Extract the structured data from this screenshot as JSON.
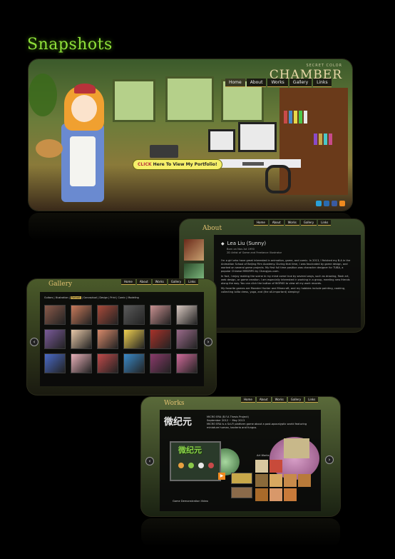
{
  "page": {
    "title": "Snapshots"
  },
  "nav": [
    "Home",
    "About",
    "Works",
    "Gallery",
    "Links"
  ],
  "brand": {
    "small": "SECRET COLOR",
    "big": "CHAMBER"
  },
  "shot1": {
    "bubble_prefix": "CLICK",
    "bubble_text": " Here To View My Portfolio!"
  },
  "about": {
    "section": "About",
    "name": "Lea Liu (Sunny)",
    "born": "Born on Nov.1st 1990",
    "role": "2D Artist of Game and Freelance Illustrator",
    "para1": "I'm a girl who have great interested in animation, game, and comic. In 2013, I finished my B.A in the Animation School of Beijing Film Academy. During that time, I was fascinated by game design, and worked on several game projects. My first full time position was character designer for TUBA, a popular Chinese MMORPG by Changyou.com.",
    "para2": "In fact, I enjoy making the scene in my mind come true by several ways, such as drawing, flash art, web design, or game creation. I am especially interested in working in a group, meeting new friends along the way. You can click the button of WORKS to view all my work records.",
    "para3": "My favorite games are Monster Hunter and Minecraft, and my hobbies include painting, cooking, collecting lolita dress, yoga, and (the all-important) sleeping!"
  },
  "gallery": {
    "section": "Gallery",
    "filters": [
      "Guitars",
      "Illustration",
      "Portrait",
      "Conceptual",
      "Design",
      "Print",
      "Comic",
      "Modeling"
    ],
    "active_filter": "Portrait",
    "thumb_colors": [
      "#8a5a4a",
      "#c87a5a",
      "#a84a3a",
      "#5a5a5a",
      "#c89090",
      "#d8c8c0",
      "#7a5a9a",
      "#e8c8a8",
      "#d88a6a",
      "#f0d050",
      "#a8322a",
      "#9a6a8a",
      "#4a6ac8",
      "#e8b0b8",
      "#c04a4a",
      "#3a8ac8",
      "#8a3a6a",
      "#d06a9a"
    ]
  },
  "works": {
    "section": "Works",
    "logo": "微纪元",
    "lines": [
      "MICRO ERA (B.F.A Thesis Project)",
      "September 2012 ~ May 2013",
      "MICRO ERA is a Sci-Fi platform game about a post-apocalyptic world featuring miniature human, bacteria and fungus."
    ],
    "game_title": "微纪元",
    "demo_caption": "Game Demonstration Video",
    "art_label": "Art Works"
  },
  "colors": {
    "accent": "#8fe03a",
    "gold": "#c8a84a",
    "nav_bg": "#1b1b12"
  },
  "icons": [
    "twitter-icon",
    "linkedin-icon",
    "facebook-icon",
    "rss-icon"
  ]
}
